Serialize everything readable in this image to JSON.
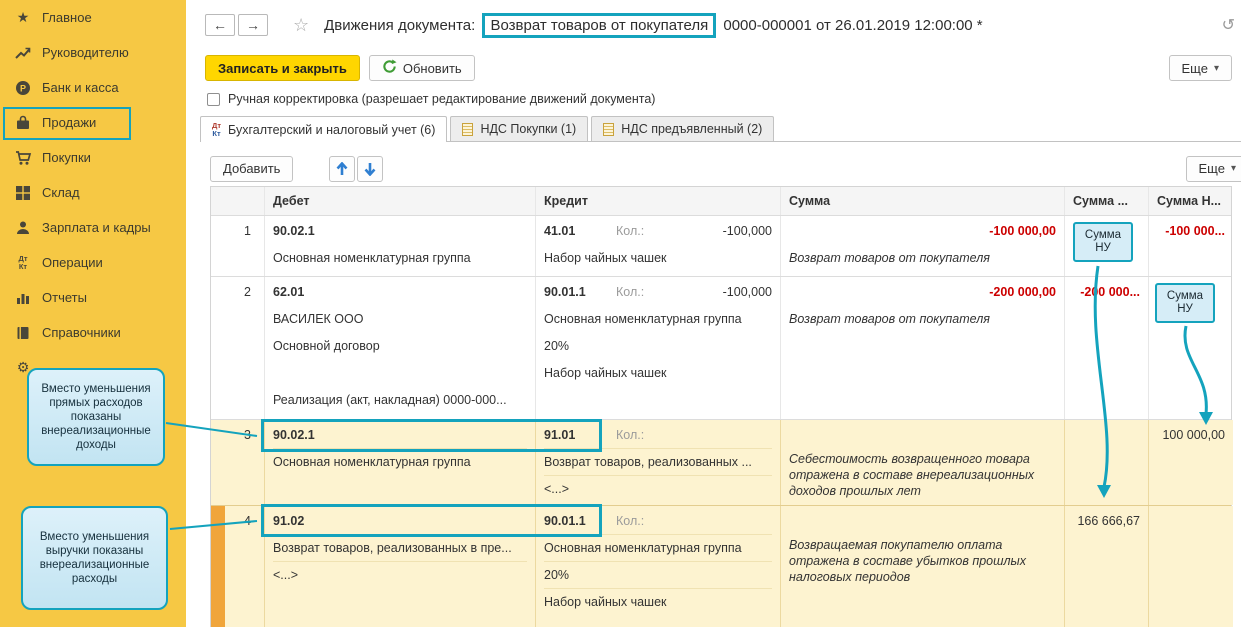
{
  "colors": {
    "accent": "#14a3bd",
    "sidebar": "#f6c844",
    "negative": "#cc0000",
    "highlight_row": "#fdf3d0",
    "selection_strip": "#f0a53b",
    "primary_button": "#ffd600"
  },
  "glyphs": {
    "back": "←",
    "forward": "→",
    "favorite": "☆",
    "dropdown": "▾",
    "link": "↺",
    "star": "★",
    "gear": "⚙",
    "dt": "Дт",
    "kt": "Кт"
  },
  "sidebar": {
    "items": [
      {
        "label": "Главное"
      },
      {
        "label": "Руководителю"
      },
      {
        "label": "Банк и касса"
      },
      {
        "label": "Продажи"
      },
      {
        "label": "Покупки"
      },
      {
        "label": "Склад"
      },
      {
        "label": "Зарплата и кадры"
      },
      {
        "label": "Операции"
      },
      {
        "label": "Отчеты"
      },
      {
        "label": "Справочники"
      }
    ]
  },
  "header": {
    "title_prefix": "Движения документа:",
    "title_highlight": "Возврат товаров от покупателя",
    "title_suffix": "0000-000001 от 26.01.2019 12:00:00 *"
  },
  "actions": {
    "save_close": "Записать и закрыть",
    "refresh": "Обновить",
    "more": "Еще"
  },
  "manual_correction_label": "Ручная корректировка (разрешает редактирование движений документа)",
  "tabs": [
    {
      "label": "Бухгалтерский и налоговый учет (6)"
    },
    {
      "label": "НДС Покупки (1)"
    },
    {
      "label": "НДС предъявленный (2)"
    }
  ],
  "toolbar": {
    "add": "Добавить",
    "more": "Еще"
  },
  "table": {
    "kol_label": "Кол.:",
    "headers": {
      "debet": "Дебет",
      "kredit": "Кредит",
      "summa": "Сумма",
      "summa_dt": "Сумма ...",
      "summa_nu": "Сумма Н..."
    },
    "rows": [
      {
        "num": "1",
        "debet": {
          "account": "90.02.1",
          "line1": "Основная номенклатурная группа"
        },
        "kredit": {
          "account": "41.01",
          "kol": "-100,000",
          "line1": "Набор чайных чашек"
        },
        "summa": {
          "value": "-100 000,00",
          "desc": "Возврат товаров от покупателя"
        },
        "summa_dt": "",
        "summa_nu": "-100 000..."
      },
      {
        "num": "2",
        "debet": {
          "account": "62.01",
          "line1": "ВАСИЛЕК ООО",
          "line2": "Основной договор",
          "line3": "Реализация (акт, накладная) 0000-000..."
        },
        "kredit": {
          "account": "90.01.1",
          "kol": "-100,000",
          "line1": "Основная номенклатурная группа",
          "line2": "20%",
          "line3": "Набор чайных чашек"
        },
        "summa": {
          "value": "-200 000,00",
          "desc": "Возврат товаров от покупателя"
        },
        "summa_dt": "-200 000...",
        "summa_nu": ""
      },
      {
        "num": "3",
        "debet": {
          "account": "90.02.1",
          "line1": "Основная номенклатурная группа"
        },
        "kredit": {
          "account": "91.01",
          "kol": "",
          "line1": "Возврат товаров, реализованных ...",
          "line2": "<...>"
        },
        "summa": {
          "value": "",
          "desc": "Себестоимость возвращенного товара отражена в составе внереализационных доходов прошлых лет"
        },
        "summa_dt": "",
        "summa_nu": "100 000,00"
      },
      {
        "num": "4",
        "debet": {
          "account": "91.02",
          "line1": "Возврат товаров, реализованных в пре...",
          "line2": "<...>"
        },
        "kredit": {
          "account": "90.01.1",
          "kol": "",
          "line1": "Основная номенклатурная группа",
          "line2": "20%",
          "line3": "Набор чайных чашек"
        },
        "summa": {
          "value": "",
          "desc": "Возвращаемая покупателю оплата отражена в составе убытков прошлых налоговых периодов"
        },
        "summa_dt": "166 666,67",
        "summa_nu": ""
      }
    ]
  },
  "annotations": {
    "nu_badge_line1": "Сумма",
    "nu_badge_line2": "НУ",
    "callout_top": "Вместо уменьшения прямых расходов показаны внереализационные доходы",
    "callout_bottom": "Вместо уменьшения выручки показаны внереализационные расходы"
  }
}
